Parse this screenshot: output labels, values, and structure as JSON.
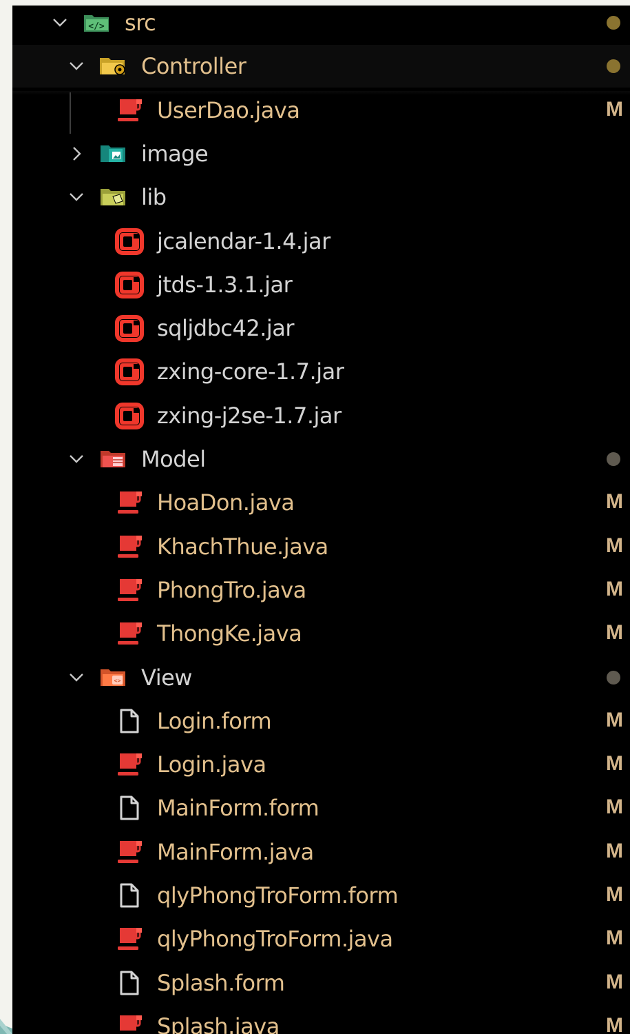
{
  "colors": {
    "background": "#000000",
    "outer": "#f3f3ee",
    "text": "#d4d4d4",
    "modified_text": "#e2c08d",
    "status": "#d2b48a",
    "dot_modified": "#8a7330",
    "dot_grey": "#5f5a50",
    "java_icon": "#e53935",
    "jar_icon": "#f0372b"
  },
  "tree": [
    {
      "label": "src",
      "type": "folder",
      "icon": "src-folder-icon",
      "expanded": true,
      "status": "",
      "dot": "modified",
      "depth": 0
    },
    {
      "label": "Controller",
      "type": "folder",
      "icon": "controller-folder-icon",
      "expanded": true,
      "status": "",
      "dot": "modified",
      "depth": 1
    },
    {
      "label": "UserDao.java",
      "type": "file",
      "icon": "java-icon",
      "status": "M",
      "depth": 2
    },
    {
      "label": "image",
      "type": "folder",
      "icon": "image-folder-icon",
      "expanded": false,
      "status": "",
      "depth": 1
    },
    {
      "label": "lib",
      "type": "folder",
      "icon": "lib-folder-icon",
      "expanded": true,
      "status": "",
      "depth": 1
    },
    {
      "label": "jcalendar-1.4.jar",
      "type": "file",
      "icon": "jar-icon",
      "status": "",
      "depth": 2
    },
    {
      "label": "jtds-1.3.1.jar",
      "type": "file",
      "icon": "jar-icon",
      "status": "",
      "depth": 2
    },
    {
      "label": "sqljdbc42.jar",
      "type": "file",
      "icon": "jar-icon",
      "status": "",
      "depth": 2
    },
    {
      "label": "zxing-core-1.7.jar",
      "type": "file",
      "icon": "jar-icon",
      "status": "",
      "depth": 2
    },
    {
      "label": "zxing-j2se-1.7.jar",
      "type": "file",
      "icon": "jar-icon",
      "status": "",
      "depth": 2
    },
    {
      "label": "Model",
      "type": "folder",
      "icon": "model-folder-icon",
      "expanded": true,
      "status": "",
      "dot": "grey",
      "depth": 1
    },
    {
      "label": "HoaDon.java",
      "type": "file",
      "icon": "java-icon",
      "status": "M",
      "depth": 2
    },
    {
      "label": "KhachThue.java",
      "type": "file",
      "icon": "java-icon",
      "status": "M",
      "depth": 2
    },
    {
      "label": "PhongTro.java",
      "type": "file",
      "icon": "java-icon",
      "status": "M",
      "depth": 2
    },
    {
      "label": "ThongKe.java",
      "type": "file",
      "icon": "java-icon",
      "status": "M",
      "depth": 2
    },
    {
      "label": "View",
      "type": "folder",
      "icon": "view-folder-icon",
      "expanded": true,
      "status": "",
      "dot": "grey",
      "depth": 1
    },
    {
      "label": "Login.form",
      "type": "file",
      "icon": "form-file-icon",
      "status": "M",
      "depth": 2
    },
    {
      "label": "Login.java",
      "type": "file",
      "icon": "java-icon",
      "status": "M",
      "depth": 2
    },
    {
      "label": "MainForm.form",
      "type": "file",
      "icon": "form-file-icon",
      "status": "M",
      "depth": 2
    },
    {
      "label": "MainForm.java",
      "type": "file",
      "icon": "java-icon",
      "status": "M",
      "depth": 2
    },
    {
      "label": "qlyPhongTroForm.form",
      "type": "file",
      "icon": "form-file-icon",
      "status": "M",
      "depth": 2
    },
    {
      "label": "qlyPhongTroForm.java",
      "type": "file",
      "icon": "java-icon",
      "status": "M",
      "depth": 2
    },
    {
      "label": "Splash.form",
      "type": "file",
      "icon": "form-file-icon",
      "status": "M",
      "depth": 2
    },
    {
      "label": "Splash.java",
      "type": "file",
      "icon": "java-icon",
      "status": "M",
      "depth": 2
    }
  ]
}
